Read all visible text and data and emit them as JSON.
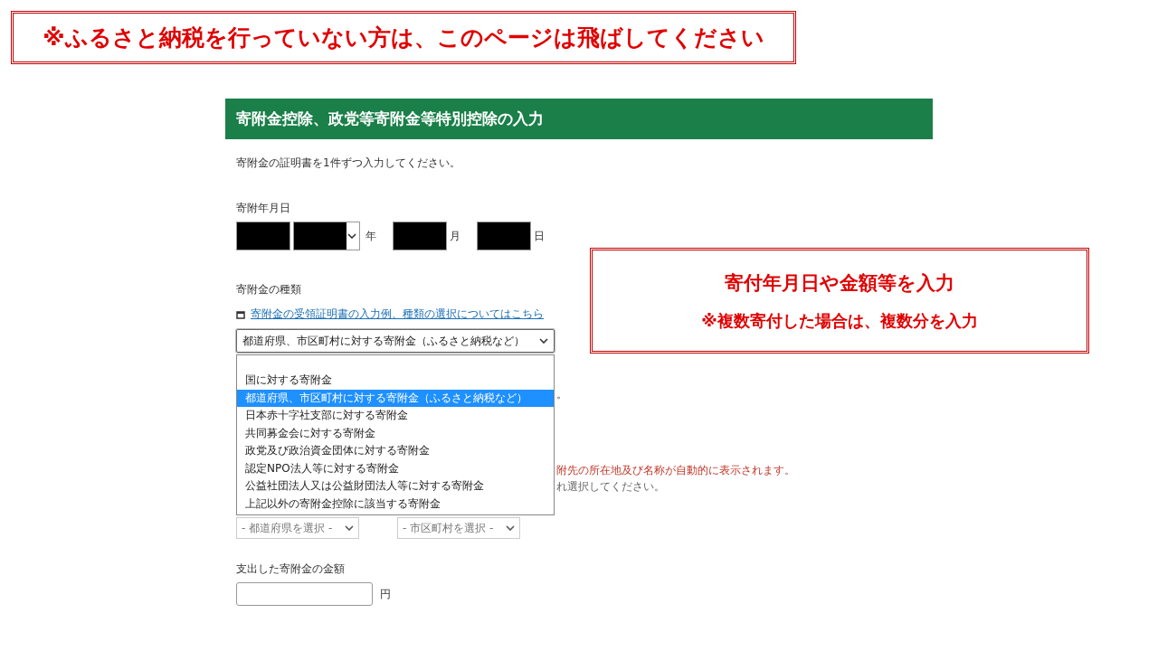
{
  "notice": {
    "text": "※ふるさと納税を行っていない方は、このページは飛ばしてください"
  },
  "form": {
    "title": "寄附金控除、政党等寄附金等特別控除の入力",
    "intro": "寄附金の証明書を1件ずつ入力してください。",
    "date": {
      "label": "寄附年月日",
      "fields": [
        {
          "redacted": true,
          "dropdown": false
        },
        {
          "redacted": true,
          "dropdown": true,
          "unit": "年"
        },
        {
          "redacted": true,
          "dropdown": false,
          "unit": "月"
        },
        {
          "redacted": true,
          "dropdown": false,
          "unit": "日"
        }
      ]
    },
    "type": {
      "label": "寄附金の種類",
      "link": "寄附金の受領証明書の入力例、種類の選択についてはこちら",
      "value": "都道府県、市区町村に対する寄附金（ふるさと納税など）",
      "expanded": true,
      "options": [
        {
          "label": "国に対する寄附金",
          "selected": false
        },
        {
          "label": "都道府県、市区町村に対する寄附金（ふるさと納税など）",
          "selected": true
        },
        {
          "label": "日本赤十字社支部に対する寄附金",
          "selected": false
        },
        {
          "label": "共同募金会に対する寄附金",
          "selected": false
        },
        {
          "label": "政党及び政治資金団体に対する寄附金",
          "selected": false
        },
        {
          "label": "認定NPO法人等に対する寄附金",
          "selected": false
        },
        {
          "label": "公益社団法人又は公益財団法人等に対する寄附金",
          "selected": false
        },
        {
          "label": "上記以外の寄附金控除に該当する寄附金",
          "selected": false
        }
      ]
    },
    "hidden_text": [
      {
        "text": "。",
        "kind": "plain"
      },
      {
        "text": "附先の所在地及び名称が自動的に表示されます。",
        "kind": "warning"
      },
      {
        "text": "れ選択してください。",
        "kind": "note"
      }
    ],
    "place_selects": [
      "- 都道府県を選択 -",
      "- 市区町村を選択 -"
    ],
    "amount": {
      "label": "支出した寄附金の金額",
      "unit": "円"
    }
  },
  "callout": {
    "title": "寄付年月日や金額等を入力",
    "note": "※複数寄付した場合は、複数分を入力"
  }
}
